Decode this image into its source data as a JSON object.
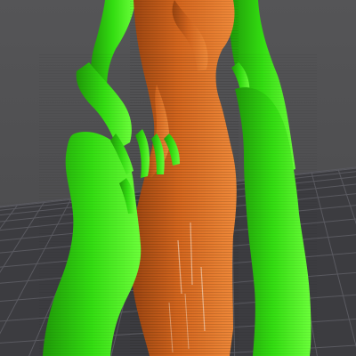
{
  "viewport": {
    "kind": "3d-print-preview",
    "background_color": "#505052",
    "bed_color": "#3c3c40",
    "bed_grid_color": "#5a5a60"
  },
  "model": {
    "figure_color": "#d4661e",
    "figure_highlight": "#f08a3a",
    "figure_shadow": "#9a4410",
    "support_color": "#33dd11",
    "support_highlight": "#6bff3a",
    "support_shadow": "#1f9a08"
  }
}
